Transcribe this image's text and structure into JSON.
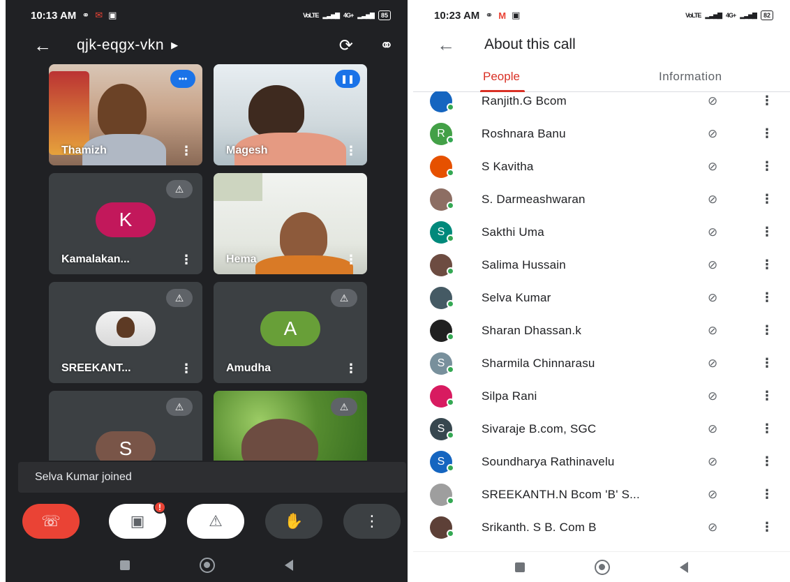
{
  "left": {
    "status": {
      "time": "10:13 AM",
      "battery": "85",
      "net": "4G+"
    },
    "meeting_code": "qjk-eqgx-vkn",
    "tiles": [
      {
        "name": "Thamizh"
      },
      {
        "name": "Magesh"
      },
      {
        "name": "Kamalakan...",
        "initial": "K",
        "color": "#c2185b"
      },
      {
        "name": "Hema"
      },
      {
        "name": "SREEKANT..."
      },
      {
        "name": "Amudha",
        "initial": "A",
        "color": "#689f38"
      },
      {
        "name": "",
        "initial": "S",
        "color": "#795548"
      },
      {
        "name": ""
      }
    ],
    "toast": "Selva Kumar joined",
    "controls": {
      "end": "end-call",
      "camera_alert": "!"
    }
  },
  "right": {
    "status": {
      "time": "10:23 AM",
      "battery": "82",
      "net": "4G+"
    },
    "title": "About this call",
    "tabs": {
      "people": "People",
      "info": "Information"
    },
    "participants": [
      {
        "name": "Ranjith.G Bcom",
        "initial": "",
        "color": "#1565c0"
      },
      {
        "name": "Roshnara Banu",
        "initial": "R",
        "color": "#43a047"
      },
      {
        "name": "S Kavitha",
        "initial": "",
        "color": "#e65100"
      },
      {
        "name": "S. Darmeashwaran",
        "initial": "",
        "color": "#8d6e63"
      },
      {
        "name": "Sakthi Uma",
        "initial": "S",
        "color": "#00897b"
      },
      {
        "name": "Salima Hussain",
        "initial": "",
        "color": "#6d4c41"
      },
      {
        "name": "Selva Kumar",
        "initial": "",
        "color": "#455a64"
      },
      {
        "name": "Sharan Dhassan.k",
        "initial": "",
        "color": "#212121"
      },
      {
        "name": "Sharmila Chinnarasu",
        "initial": "S",
        "color": "#78909c"
      },
      {
        "name": "Silpa Rani",
        "initial": "",
        "color": "#d81b60"
      },
      {
        "name": "Sivaraje B.com, SGC",
        "initial": "S",
        "color": "#37474f"
      },
      {
        "name": "Soundharya Rathinavelu",
        "initial": "S",
        "color": "#1565c0"
      },
      {
        "name": "SREEKANTH.N Bcom 'B' S...",
        "initial": "",
        "color": "#9e9e9e"
      },
      {
        "name": "Srikanth. S B. Com B",
        "initial": "",
        "color": "#5d4037"
      }
    ]
  }
}
